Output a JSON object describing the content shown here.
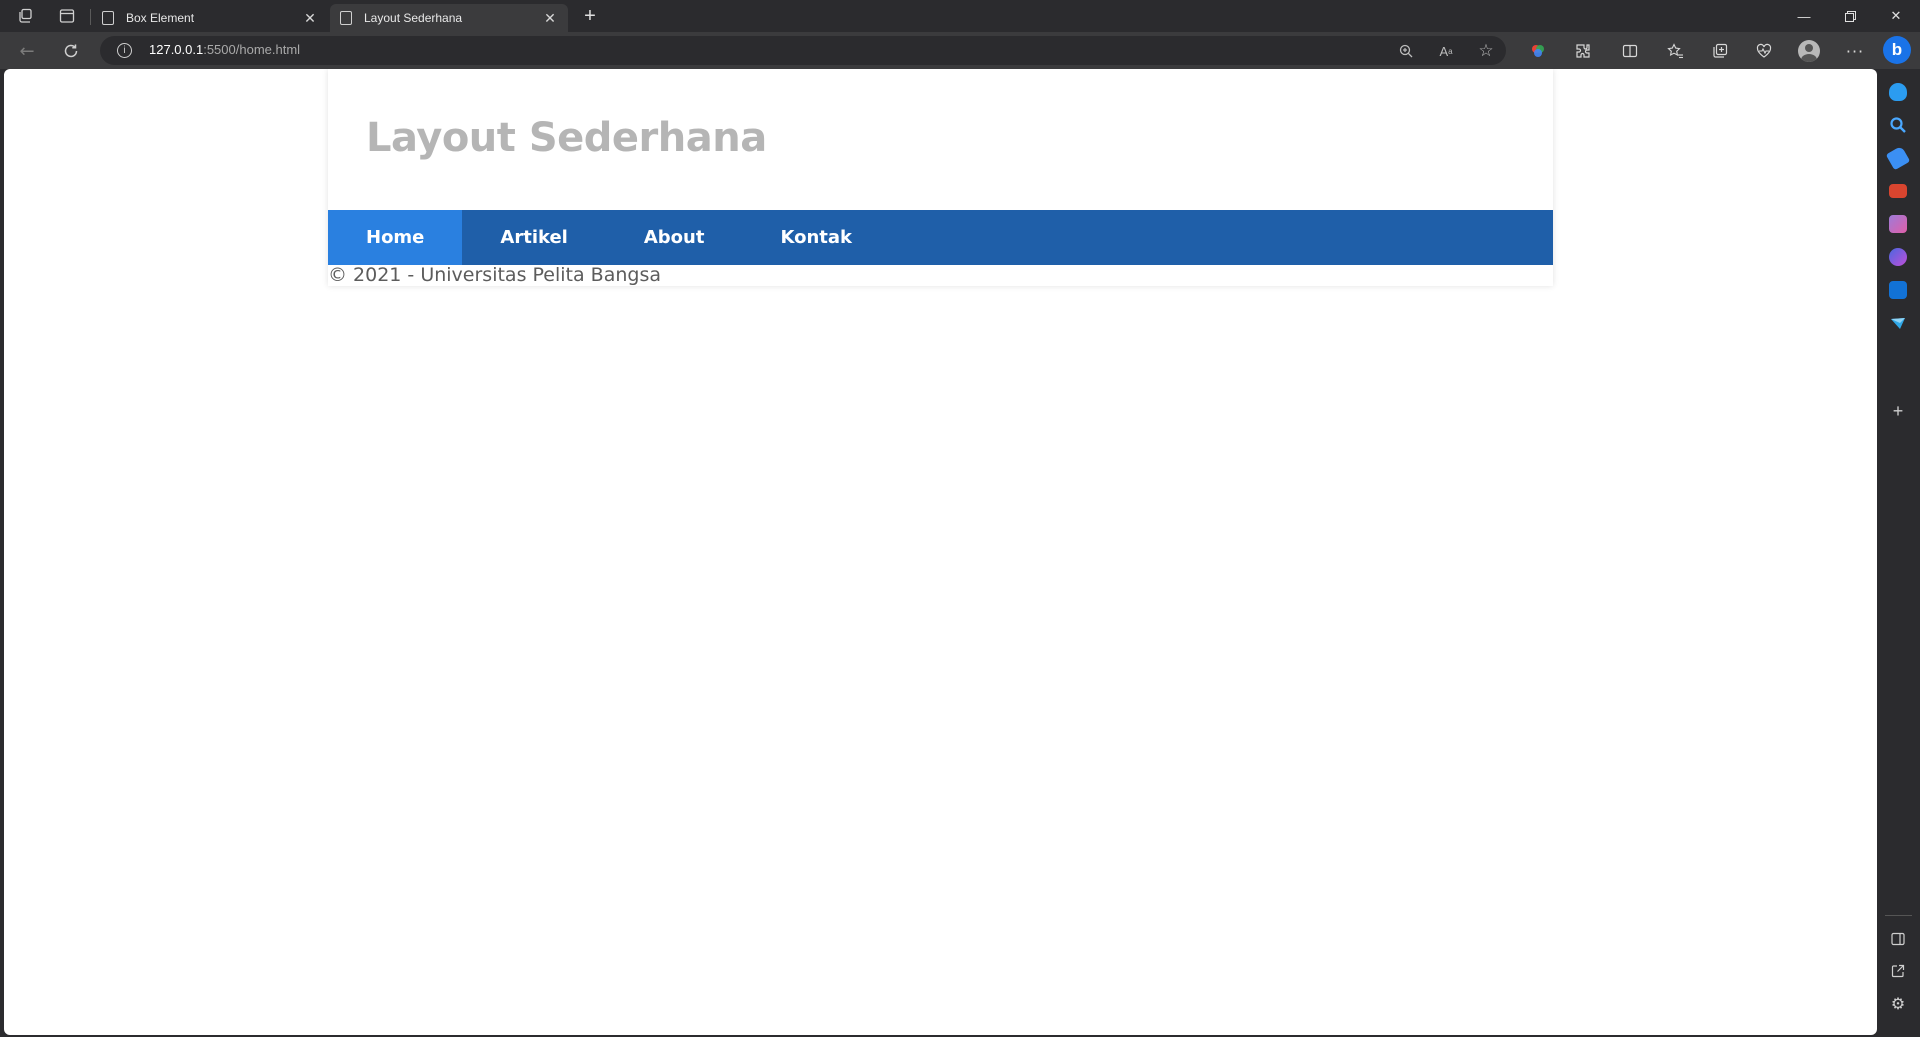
{
  "browser": {
    "tabs": [
      {
        "title": "Box Element",
        "active": false
      },
      {
        "title": "Layout Sederhana",
        "active": true
      }
    ],
    "url_host": "127.0.0.1",
    "url_rest": ":5500/home.html"
  },
  "page": {
    "title": "Layout Sederhana",
    "nav": [
      "Home",
      "Artikel",
      "About",
      "Kontak"
    ],
    "active_nav": "Home",
    "footer": "© 2021 - Universitas Pelita Bangsa"
  },
  "colors": {
    "nav_bg": "#1f5fa9",
    "nav_active": "#2a80e0",
    "title_color": "#b5b5b5"
  }
}
